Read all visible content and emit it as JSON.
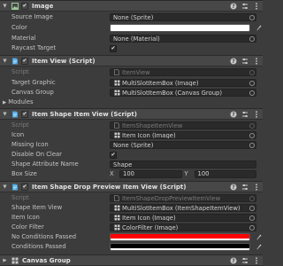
{
  "components": [
    {
      "title": "Image",
      "rows": [
        {
          "label": "Source Image",
          "value": "None (Sprite)"
        },
        {
          "label": "Color",
          "value": ""
        },
        {
          "label": "Material",
          "value": "None (Material)"
        },
        {
          "label": "Raycast Target",
          "value": "✔"
        }
      ]
    },
    {
      "title": "Item View (Script)",
      "rows": [
        {
          "label": "Script",
          "value": "ItemView"
        },
        {
          "label": "Target Graphic",
          "value": "MultiSlotItemBox (Image)"
        },
        {
          "label": "Canvas Group",
          "value": "MultiSlotItemBox (Canvas Group)"
        },
        {
          "label": "Modules",
          "value": ""
        }
      ]
    },
    {
      "title": "Item Shape Item View (Script)",
      "rows": [
        {
          "label": "Script",
          "value": "ItemShapeItemView"
        },
        {
          "label": "Icon",
          "value": "Item Icon (Image)"
        },
        {
          "label": "Missing Icon",
          "value": "None (Sprite)"
        },
        {
          "label": "Disable On Clear",
          "value": "✔"
        },
        {
          "label": "Shape Attribute Name",
          "value": "Shape"
        },
        {
          "label": "Box Size",
          "x_label": "X",
          "x_value": "100",
          "y_label": "Y",
          "y_value": "100"
        }
      ]
    },
    {
      "title": "Item Shape Drop Preview Item View (Script)",
      "rows": [
        {
          "label": "Script",
          "value": "ItemShapeDropPreviewItemView"
        },
        {
          "label": "Shape Item View",
          "value": "MultiSlotItemBox (ItemShapeItemView)"
        },
        {
          "label": "Item Icon",
          "value": "Item Icon (Image)"
        },
        {
          "label": "Color Filter",
          "value": "ColorFilter (Image)"
        },
        {
          "label": "No Conditions Passed",
          "value": ""
        },
        {
          "label": "Conditions Passed",
          "value": ""
        }
      ]
    },
    {
      "title": "Canvas Group",
      "rows": []
    }
  ],
  "colors": {
    "color_field": "#ffffff",
    "no_conditions_passed": "#ff0000",
    "conditions_passed": "#000000",
    "script_icon": "#4aa3df",
    "image_icon": "#7fbf7f"
  },
  "icons": {
    "help": "question-circle-icon",
    "preset": "sliders-icon",
    "menu": "vertical-ellipsis-icon",
    "foldout_open": "triangle-down-icon",
    "foldout_closed": "triangle-right-icon",
    "object_picker": "circle-target-icon",
    "eyedropper": "eyedropper-icon"
  }
}
